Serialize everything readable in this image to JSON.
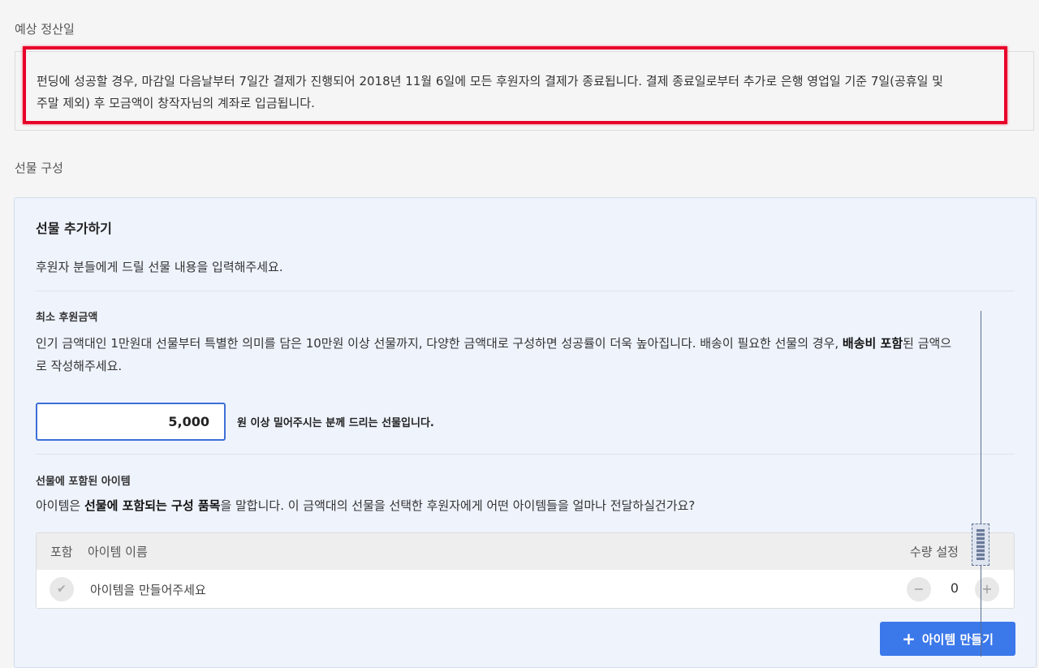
{
  "settlement": {
    "label": "예상 정산일",
    "text_line1": "펀딩에 성공할 경우, 마감일 다음날부터 7일간 결제가 진행되어 2018년 11월 6일에 모든 후원자의 결제가 종료됩니다. 결제 종료일로부터 추가로 은행 영업일 기준 7일(공휴일 및",
    "text_line2": "주말 제외) 후 모금액이 창작자님의 계좌로 입금됩니다."
  },
  "gift": {
    "label": "선물 구성",
    "panel_title": "선물 추가하기",
    "panel_desc": "후원자 분들에게 드릴 선물 내용을 입력해주세요.",
    "min_amount": {
      "title": "최소 후원금액",
      "desc_part1": "인기 금액대인 1만원대 선물부터 특별한 의미를 담은 10만원 이상 선물까지, 다양한 금액대로 구성하면 성공률이 더욱 높아집니다. 배송이 필요한 선물의 경우, ",
      "desc_bold": "배송비 포함",
      "desc_part2": "된 금액으",
      "desc_line2": "로 작성해주세요.",
      "value": "5,000",
      "suffix": "원 이상 밀어주시는 분께 드리는 선물입니다."
    },
    "items": {
      "title": "선물에 포함된 아이템",
      "desc_part1": "아이템은 ",
      "desc_bold": "선물에 포함되는 구성 품목",
      "desc_part2": "을 말합니다. 이 금액대의 선물을 선택한 후원자에게 어떤 아이템들을 얼마나 전달하실건가요?",
      "col_include": "포함",
      "col_name": "아이템 이름",
      "col_qty": "수량 설정",
      "row_name": "아이템을 만들어주세요",
      "row_qty": "0",
      "minus": "−",
      "plus": "+",
      "check": "✔",
      "make_button": "아이템 만들기",
      "make_button_icon": "+"
    }
  },
  "colors": {
    "highlight": "#e8002a",
    "accent": "#3b78ea",
    "input_border": "#3d6fd6",
    "panel_bg": "#eef3fc"
  }
}
